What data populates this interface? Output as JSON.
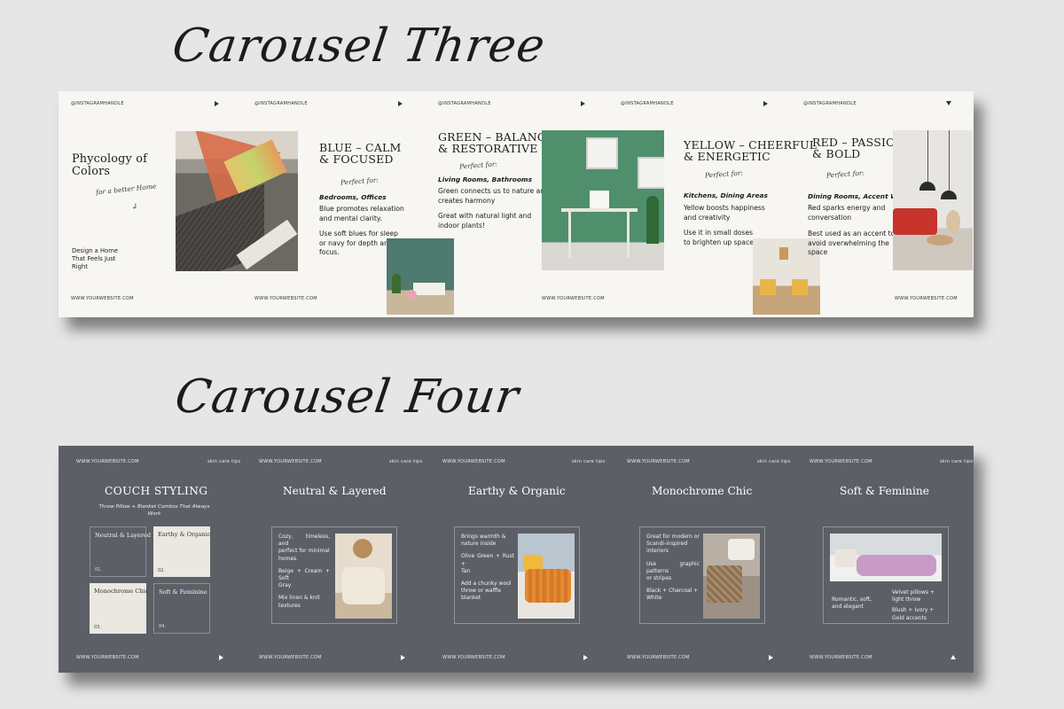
{
  "headings": {
    "carousel3": "Carousel Three",
    "carousel4": "Carousel Four"
  },
  "c3": {
    "handle": "@INSTAGRAMHANDLE",
    "website": "WWW.YOURWEBSITE.COM",
    "slide1": {
      "title_line1": "Phycology of",
      "title_line2": "Colors",
      "tagline": "for a better Home",
      "body_line1": "Design a Home",
      "body_line2": "That Feels Just",
      "body_line3": "Right"
    },
    "blue": {
      "title_line1": "BLUE – CALM",
      "title_line2": "& FOCUSED",
      "perfect": "Perfect for:",
      "rooms": "Bedrooms, Offices",
      "p1_line1": "Blue promotes relaxation",
      "p1_line2": "and mental clarity.",
      "p2_line1": "Use soft blues for sleep",
      "p2_line2": "or navy for depth and",
      "p2_line3": "focus."
    },
    "green": {
      "title_line1": "GREEN – BALANCED",
      "title_line2": "& RESTORATIVE",
      "perfect": "Perfect for:",
      "rooms": "Living Rooms, Bathrooms",
      "p1_line1": "Green connects us to nature and",
      "p1_line2": "creates harmony",
      "p2_line1": "Great with natural light and",
      "p2_line2": "indoor plants!"
    },
    "yellow": {
      "title_line1": "YELLOW – CHEERFUL",
      "title_line2": "& ENERGETIC",
      "perfect": "Perfect for:",
      "rooms": "Kitchens, Dining Areas",
      "p1_line1": "Yellow boosts happiness",
      "p1_line2": "and creativity",
      "p2_line1": "Use it in small doses",
      "p2_line2": "to brighten up spaces"
    },
    "red": {
      "title_line1": "RED – PASSIONATE",
      "title_line2": "& BOLD",
      "perfect": "Perfect for:",
      "rooms": "Dining Rooms, Accent Walls",
      "p1_line1": "Red sparks energy and",
      "p1_line2": "conversation",
      "p2_line1": "Best used as an accent to",
      "p2_line2": "avoid overwhelming the",
      "p2_line3": "space"
    }
  },
  "c4": {
    "website": "WWW.YOURWEBSITE.COM",
    "tag": "skin care tips",
    "slide1": {
      "title": "COUCH STYLING",
      "sub_line1": "Throw Pillow + Blanket Combos That Always",
      "sub_line2": "Work",
      "tiles": [
        {
          "label": "Neutral & Layered",
          "num": "01."
        },
        {
          "label": "Earthy & Organic",
          "num": "02."
        },
        {
          "label": "Monochrome Chic",
          "num": "03."
        },
        {
          "label": "Soft & Feminine",
          "num": "04."
        }
      ]
    },
    "neutral": {
      "title": "Neutral & Layered",
      "p1_line1": "Cozy, timeless, and",
      "p1_line2": "perfect for minimal",
      "p1_line3": "homes.",
      "p2_line1": "Beige + Cream + Soft",
      "p2_line2": "Gray",
      "p3_line1": "Mix linen & knit",
      "p3_line2": "textures"
    },
    "earthy": {
      "title": "Earthy & Organic",
      "p1_line1": "Brings warmth &",
      "p1_line2": "nature inside",
      "p2_line1": "Olive Green + Rust +",
      "p2_line2": "Tan",
      "p3_line1": "Add a chunky wool",
      "p3_line2": "throw or waffle",
      "p3_line3": "blanket"
    },
    "mono": {
      "title": "Monochrome Chic",
      "p1_line1": "Great for modern or",
      "p1_line2": "Scandi-inspired",
      "p1_line3": "interiors",
      "p2_line1": "Use graphic patterns",
      "p2_line2": "or stripes",
      "p3_line1": "Black + Charcoal +",
      "p3_line2": "White"
    },
    "soft": {
      "title": "Soft & Feminine",
      "p1_line1": "Romantic, soft,",
      "p1_line2": "and elegant",
      "p2_line1": "Velvet pillows +",
      "p2_line2": "light throw",
      "p3_line1": "Blush + Ivory +",
      "p3_line2": "Gold accents"
    }
  },
  "colors": {
    "strip3_bg": "#f7f6f3",
    "strip4_bg": "#5c6066",
    "page_bg": "#e6e6e6"
  }
}
